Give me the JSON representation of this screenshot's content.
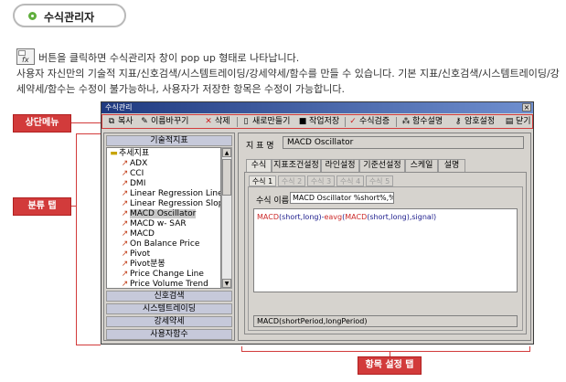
{
  "header": {
    "title": "수식관리자"
  },
  "description": {
    "line1": "버튼을 클릭하면 수식관리자 창이 pop up 형태로 나타납니다.",
    "line2": "사용자 자신만의 기술적 지표/신호검색/시스템트레이딩/강세약세/함수를 만들 수 있습니다. 기본 지표/신호검색/시스템트레이딩/강세약세/함수는 수정이 불가능하나, 사용자가 저장한 항목은 수정이 가능합니다.",
    "icon": "formula-manager-icon"
  },
  "callouts": {
    "top_menu": "상단메뉴",
    "category_tab": "분류 탭",
    "item_settings_tab": "항목 설정 탭"
  },
  "dialog": {
    "title": "수식관리",
    "toolbar": [
      {
        "label": "복사",
        "icon": "copy-icon"
      },
      {
        "label": "이름바꾸기",
        "icon": "rename-icon"
      },
      {
        "label": "삭제",
        "icon": "delete-icon"
      },
      {
        "label": "새로만들기",
        "icon": "new-icon"
      },
      {
        "label": "작업저장",
        "icon": "save-icon"
      },
      {
        "label": "수식검증",
        "icon": "check-icon"
      },
      {
        "label": "함수설명",
        "icon": "function-help-icon"
      },
      {
        "label": "암호설정",
        "icon": "key-icon"
      },
      {
        "label": "닫기",
        "icon": "close-icon"
      }
    ],
    "left_panel": {
      "header": "기술적지표",
      "tree_root": "추세지표",
      "items": [
        "ADX",
        "CCI",
        "DMI",
        "Linear Regression Line",
        "Linear Regression Slope",
        "MACD Oscillator",
        "MACD w- SAR",
        "MACD",
        "On Balance Price",
        "Pivot",
        "Pivot분봉",
        "Price Change Line",
        "Price Volume Trend"
      ],
      "selected_item": "MACD Oscillator",
      "categories": [
        "신호검색",
        "시스템트레이딩",
        "강세약세",
        "사용자함수"
      ]
    },
    "right_panel": {
      "name_label": "지 표 명",
      "name_value": "MACD Oscillator",
      "tabs": [
        "수식",
        "지표조건설정",
        "라인설정",
        "기준선설정",
        "스케일",
        "설명"
      ],
      "active_tab": "수식",
      "formula_tabs": [
        "수식 1",
        "수식 2",
        "수식 3",
        "수식 4",
        "수식 5"
      ],
      "active_formula_tab": "수식 1",
      "formula_name_label": "수식 이름",
      "formula_name_value": "MACD Oscillator %short%,%",
      "formula": {
        "p1": "MACD",
        "p2": "(short,long)-",
        "p3": "eavg",
        "p4": "(",
        "p5": "MACD",
        "p6": "(short,long),signal)"
      },
      "signature": "MACD(shortPeriod,longPeriod)"
    }
  },
  "colors": {
    "callout_red": "#d23b3b",
    "title_gradient_start": "#203a80",
    "dialog_face": "#d6d3ce",
    "pill_dot_green": "#5fae3c"
  }
}
